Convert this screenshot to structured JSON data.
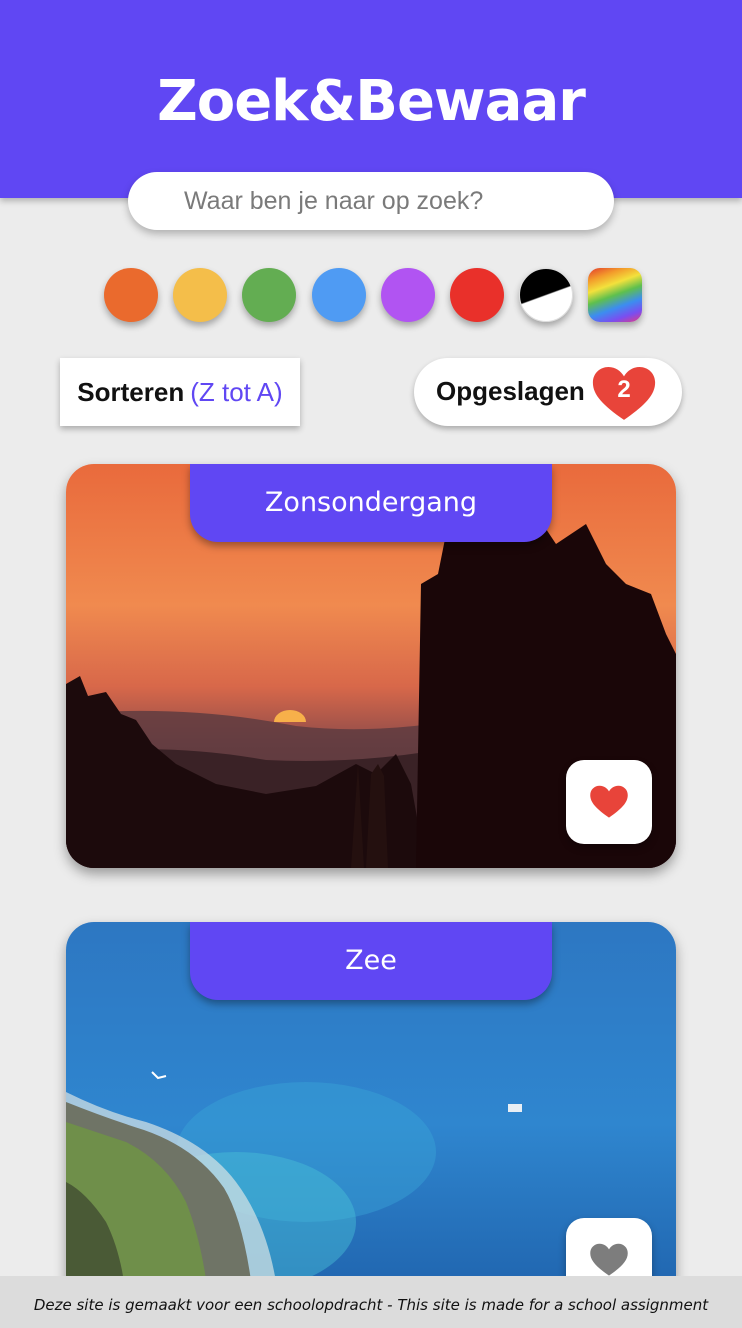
{
  "header": {
    "title": "Zoek&Bewaar"
  },
  "search": {
    "placeholder": "Waar ben je naar op zoek?"
  },
  "color_filters": [
    {
      "name": "orange",
      "color": "#ea6a2d"
    },
    {
      "name": "yellow",
      "color": "#f4be4a"
    },
    {
      "name": "green",
      "color": "#63ad52"
    },
    {
      "name": "blue",
      "color": "#4f9bf3"
    },
    {
      "name": "purple",
      "color": "#b154f2"
    },
    {
      "name": "red",
      "color": "#e9302a"
    },
    {
      "name": "black-white",
      "color": "#000000"
    },
    {
      "name": "multicolor",
      "color": "rainbow"
    }
  ],
  "sort": {
    "label": "Sorteren",
    "mode": "(Z tot A)"
  },
  "saved": {
    "label": "Opgeslagen",
    "count": "2"
  },
  "cards": [
    {
      "title": "Zonsondergang",
      "favorited": true
    },
    {
      "title": "Zee",
      "favorited": false
    }
  ],
  "footer": {
    "text": "Deze site is gemaakt voor een schoolopdracht - This site is made for a school assignment"
  },
  "colors": {
    "accent": "#6047f3",
    "heart_red": "#e8443a",
    "heart_grey": "#7d7d7d"
  }
}
